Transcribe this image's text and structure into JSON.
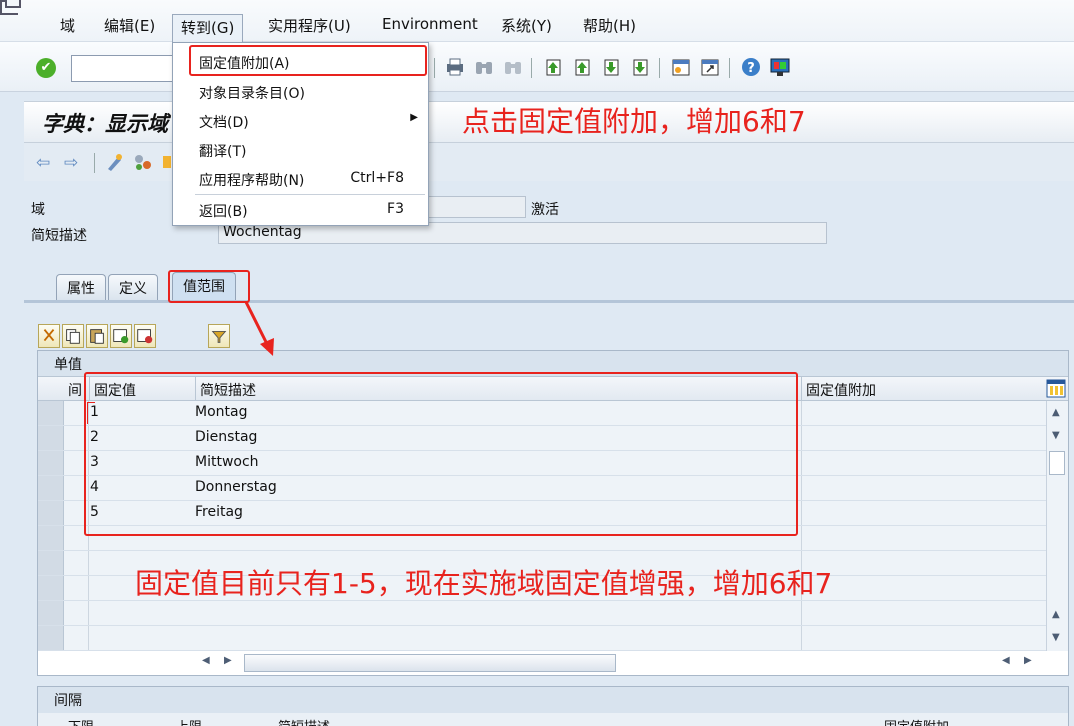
{
  "menubar": {
    "items": [
      "域",
      "编辑(E)",
      "转到(G)",
      "实用程序(U)",
      "Environment",
      "系统(Y)",
      "帮助(H)"
    ]
  },
  "title": "字典：显示域",
  "header": {
    "domain_label": "域",
    "status": "激活",
    "short_desc_label": "简短描述",
    "short_desc_value": "Wochentag"
  },
  "tabs": [
    "属性",
    "定义",
    "值范围"
  ],
  "values": {
    "caption": "单值",
    "columns": [
      "间",
      "固定值",
      "简短描述",
      "固定值附加"
    ],
    "rows": [
      {
        "value": "1",
        "desc": "Montag"
      },
      {
        "value": "2",
        "desc": "Dienstag"
      },
      {
        "value": "3",
        "desc": "Mittwoch"
      },
      {
        "value": "4",
        "desc": "Donnerstag"
      },
      {
        "value": "5",
        "desc": "Freitag"
      }
    ]
  },
  "intervals": {
    "caption": "间隔",
    "columns": [
      "下限",
      "上限",
      "简短描述",
      "固定值附加"
    ]
  },
  "dropdown": {
    "items": [
      {
        "label": "固定值附加(A)",
        "shortcut": ""
      },
      {
        "label": "对象目录条目(O)",
        "shortcut": ""
      },
      {
        "label": "文档(D)",
        "shortcut": ""
      },
      {
        "label": "翻译(T)",
        "shortcut": ""
      },
      {
        "label": "应用程序帮助(N)",
        "shortcut": "Ctrl+F8"
      },
      {
        "label": "返回(B)",
        "shortcut": "F3"
      }
    ]
  },
  "annotations": {
    "top": "点击固定值附加，增加6和7",
    "middle": "固定值目前只有1-5，现在实施域固定值增强，增加6和7",
    "color": "#e8231e"
  }
}
